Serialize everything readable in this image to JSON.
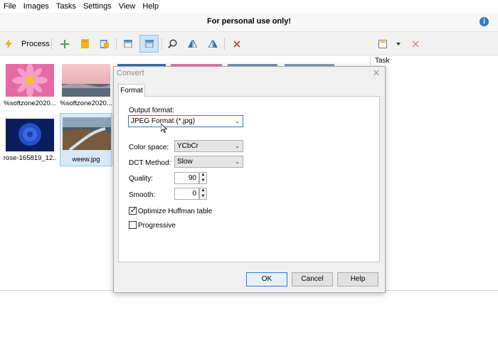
{
  "menu": [
    "File",
    "Images",
    "Tasks",
    "Settings",
    "View",
    "Help"
  ],
  "banner": {
    "text": "For personal use only!",
    "info_icon": "i"
  },
  "toolbar": {
    "process_label": "Process",
    "icons": [
      "lightning-icon",
      "add-icon",
      "folder-icon",
      "paste-icon",
      "view-list-icon",
      "view-thumbs-icon",
      "zoom-icon",
      "flip-vertical-icon",
      "flip-horizontal-icon",
      "delete-icon",
      "panel-icon",
      "dropdown-icon",
      "close-icon"
    ]
  },
  "thumbnails": [
    {
      "caption": "%softzone2020..."
    },
    {
      "caption": "%softzone2020..."
    },
    {
      "caption": "rose-165819_12..."
    },
    {
      "caption": "weew.jpg"
    }
  ],
  "task_panel": {
    "label": "Task"
  },
  "dialog": {
    "title": "Convert",
    "close": "✕",
    "tab": "Format",
    "output_format_label": "Output format:",
    "output_format_value": "JPEG Format (*.jpg)",
    "color_space_label": "Color space:",
    "color_space_value": "YCbCr",
    "dct_label": "DCT Method:",
    "dct_value": "Slow",
    "quality_label": "Quality:",
    "quality_value": "90",
    "smooth_label": "Smooth:",
    "smooth_value": "0",
    "optimize_label": "Optimize Huffman table",
    "optimize_checked": true,
    "progressive_label": "Progressive",
    "progressive_checked": false,
    "ok": "OK",
    "cancel": "Cancel",
    "help": "Help"
  },
  "colors": {
    "accent": "#2e7cd6",
    "info": "#2f77c8",
    "delete": "#d23a3a",
    "add": "#3aa655"
  }
}
